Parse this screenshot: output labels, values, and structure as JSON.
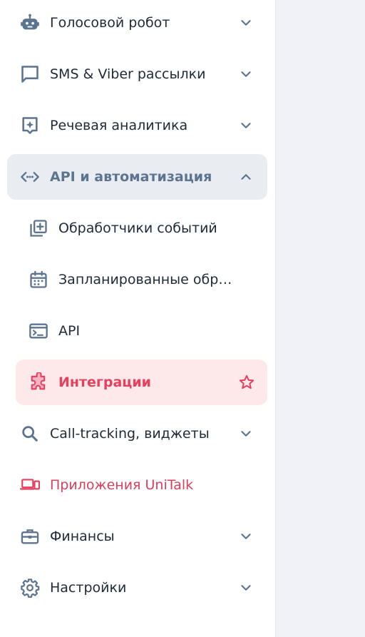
{
  "colors": {
    "icon": "#5d7490",
    "text": "#1f2937",
    "expanded_bg": "#e9edf2",
    "active_bg": "#fde8ea",
    "accent": "#e5405e",
    "content_bg": "#f0f2f7"
  },
  "sidebar": {
    "items": [
      {
        "label": "Голосовой робот",
        "icon": "robot-icon",
        "chevron": "down"
      },
      {
        "label": "SMS & Viber рассылки",
        "icon": "message-icon",
        "chevron": "down"
      },
      {
        "label": "Речевая аналитика",
        "icon": "sparkle-chat-icon",
        "chevron": "down"
      },
      {
        "label": "API и автоматизация",
        "icon": "api-icon",
        "chevron": "up",
        "state": "expanded"
      },
      {
        "label": "Call-tracking, виджеты",
        "icon": "search-icon",
        "chevron": "down"
      },
      {
        "label": "Приложения UniTalk",
        "icon": "devices-icon"
      },
      {
        "label": "Финансы",
        "icon": "briefcase-icon",
        "chevron": "down"
      },
      {
        "label": "Настройки",
        "icon": "gear-icon",
        "chevron": "down"
      }
    ],
    "subitems": [
      {
        "label": "Обработчики событий",
        "icon": "library-add-icon"
      },
      {
        "label": "Запланированные обработки",
        "icon": "calendar-icon"
      },
      {
        "label": "API",
        "icon": "terminal-icon"
      },
      {
        "label": "Интеграции",
        "icon": "puzzle-icon",
        "state": "active",
        "favorite": true
      }
    ]
  }
}
